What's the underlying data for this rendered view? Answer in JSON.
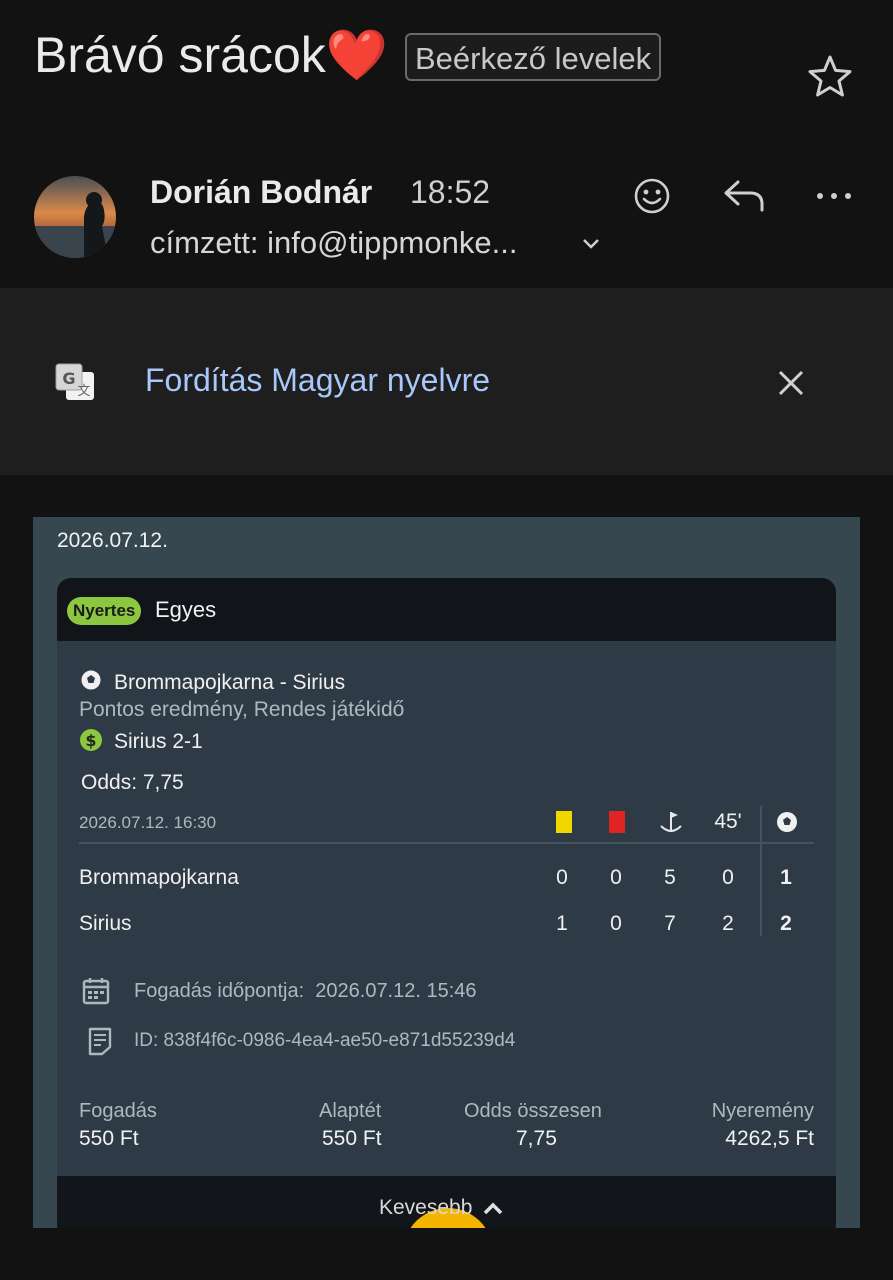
{
  "header": {
    "subject": "Brávó srácok",
    "subject_emoji": "❤️",
    "label": "Beérkező levelek",
    "star_icon": "star-icon"
  },
  "sender": {
    "name": "Dorián Bodnár",
    "time": "18:52",
    "recipient": "címzett: info@tippmonke..."
  },
  "translate": {
    "text": "Fordítás Magyar nyelvre",
    "icon": "translate-icon",
    "link_color": "#a8c7fa"
  },
  "bet": {
    "date": "2026.07.12.",
    "status_badge": "Nyertes",
    "status_color": "#8dc63f",
    "type": "Egyes",
    "match": "Brommapojkarna - Sirius",
    "market": "Pontos eredmény, Rendes játékidő",
    "selection": "Sirius 2-1",
    "odds": "Odds: 7,75",
    "match_datetime": "2026.07.12.  16:30",
    "stat_headers": {
      "minute": "45'"
    },
    "teams": [
      {
        "name": "Brommapojkarna",
        "yellow": "0",
        "red": "0",
        "corners": "5",
        "ht": "0",
        "goals": "1"
      },
      {
        "name": "Sirius",
        "yellow": "1",
        "red": "0",
        "corners": "7",
        "ht": "2",
        "goals": "2"
      }
    ],
    "bet_time_label": "Fogadás időpontja:",
    "bet_time": "2026.07.12.  15:46",
    "bet_id": "ID: 838f4f6c-0986-4ea4-ae50-e871d55239d4",
    "summary": {
      "stake_label": "Fogadás",
      "stake": "550 Ft",
      "base_label": "Alaptét",
      "base": "550 Ft",
      "odds_label": "Odds összesen",
      "odds_total": "7,75",
      "win_label": "Nyeremény",
      "win": "4262,5 Ft"
    },
    "less_label": "Kevesebb"
  }
}
